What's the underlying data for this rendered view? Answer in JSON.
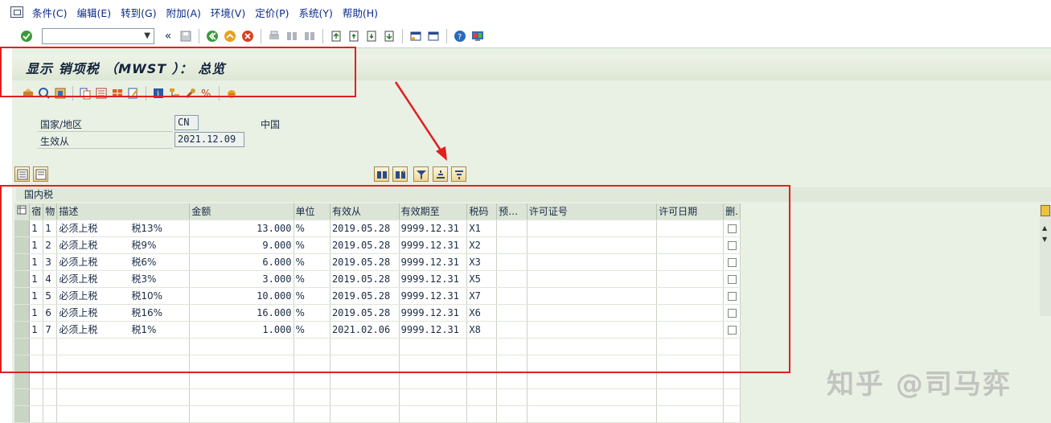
{
  "menu": [
    "条件(C)",
    "编辑(E)",
    "转到(G)",
    "附加(A)",
    "环境(V)",
    "定价(P)",
    "系统(Y)",
    "帮助(H)"
  ],
  "title": "显示 销项税 （MWST ）： 总览",
  "fields": {
    "country_label": "国家/地区",
    "country_value": "CN",
    "country_name": "中国",
    "valid_from_label": "生效从",
    "valid_from_value": "2021.12.09"
  },
  "grid": {
    "section_title": "国内税",
    "columns": [
      "宿",
      "物",
      "描述",
      "金额",
      "单位",
      "有效从",
      "有效期至",
      "税码",
      "预…",
      "许可证号",
      "许可日期",
      "删."
    ],
    "rows": [
      [
        "1",
        "1",
        "必须上税",
        "税13%",
        "13.000",
        "%",
        "2019.05.28",
        "9999.12.31",
        "X1"
      ],
      [
        "1",
        "2",
        "必须上税",
        "税9%",
        "9.000",
        "%",
        "2019.05.28",
        "9999.12.31",
        "X2"
      ],
      [
        "1",
        "3",
        "必须上税",
        "税6%",
        "6.000",
        "%",
        "2019.05.28",
        "9999.12.31",
        "X3"
      ],
      [
        "1",
        "4",
        "必须上税",
        "税3%",
        "3.000",
        "%",
        "2019.05.28",
        "9999.12.31",
        "X5"
      ],
      [
        "1",
        "5",
        "必须上税",
        "税10%",
        "10.000",
        "%",
        "2019.05.28",
        "9999.12.31",
        "X7"
      ],
      [
        "1",
        "6",
        "必须上税",
        "税16%",
        "16.000",
        "%",
        "2019.05.28",
        "9999.12.31",
        "X6"
      ],
      [
        "1",
        "7",
        "必须上税",
        "税1%",
        "1.000",
        "%",
        "2021.02.06",
        "9999.12.31",
        "X8"
      ]
    ]
  },
  "watermark": "知乎 @司马弈",
  "colors": {
    "annotation": "#e02020",
    "accent": "#0a2a8a"
  }
}
